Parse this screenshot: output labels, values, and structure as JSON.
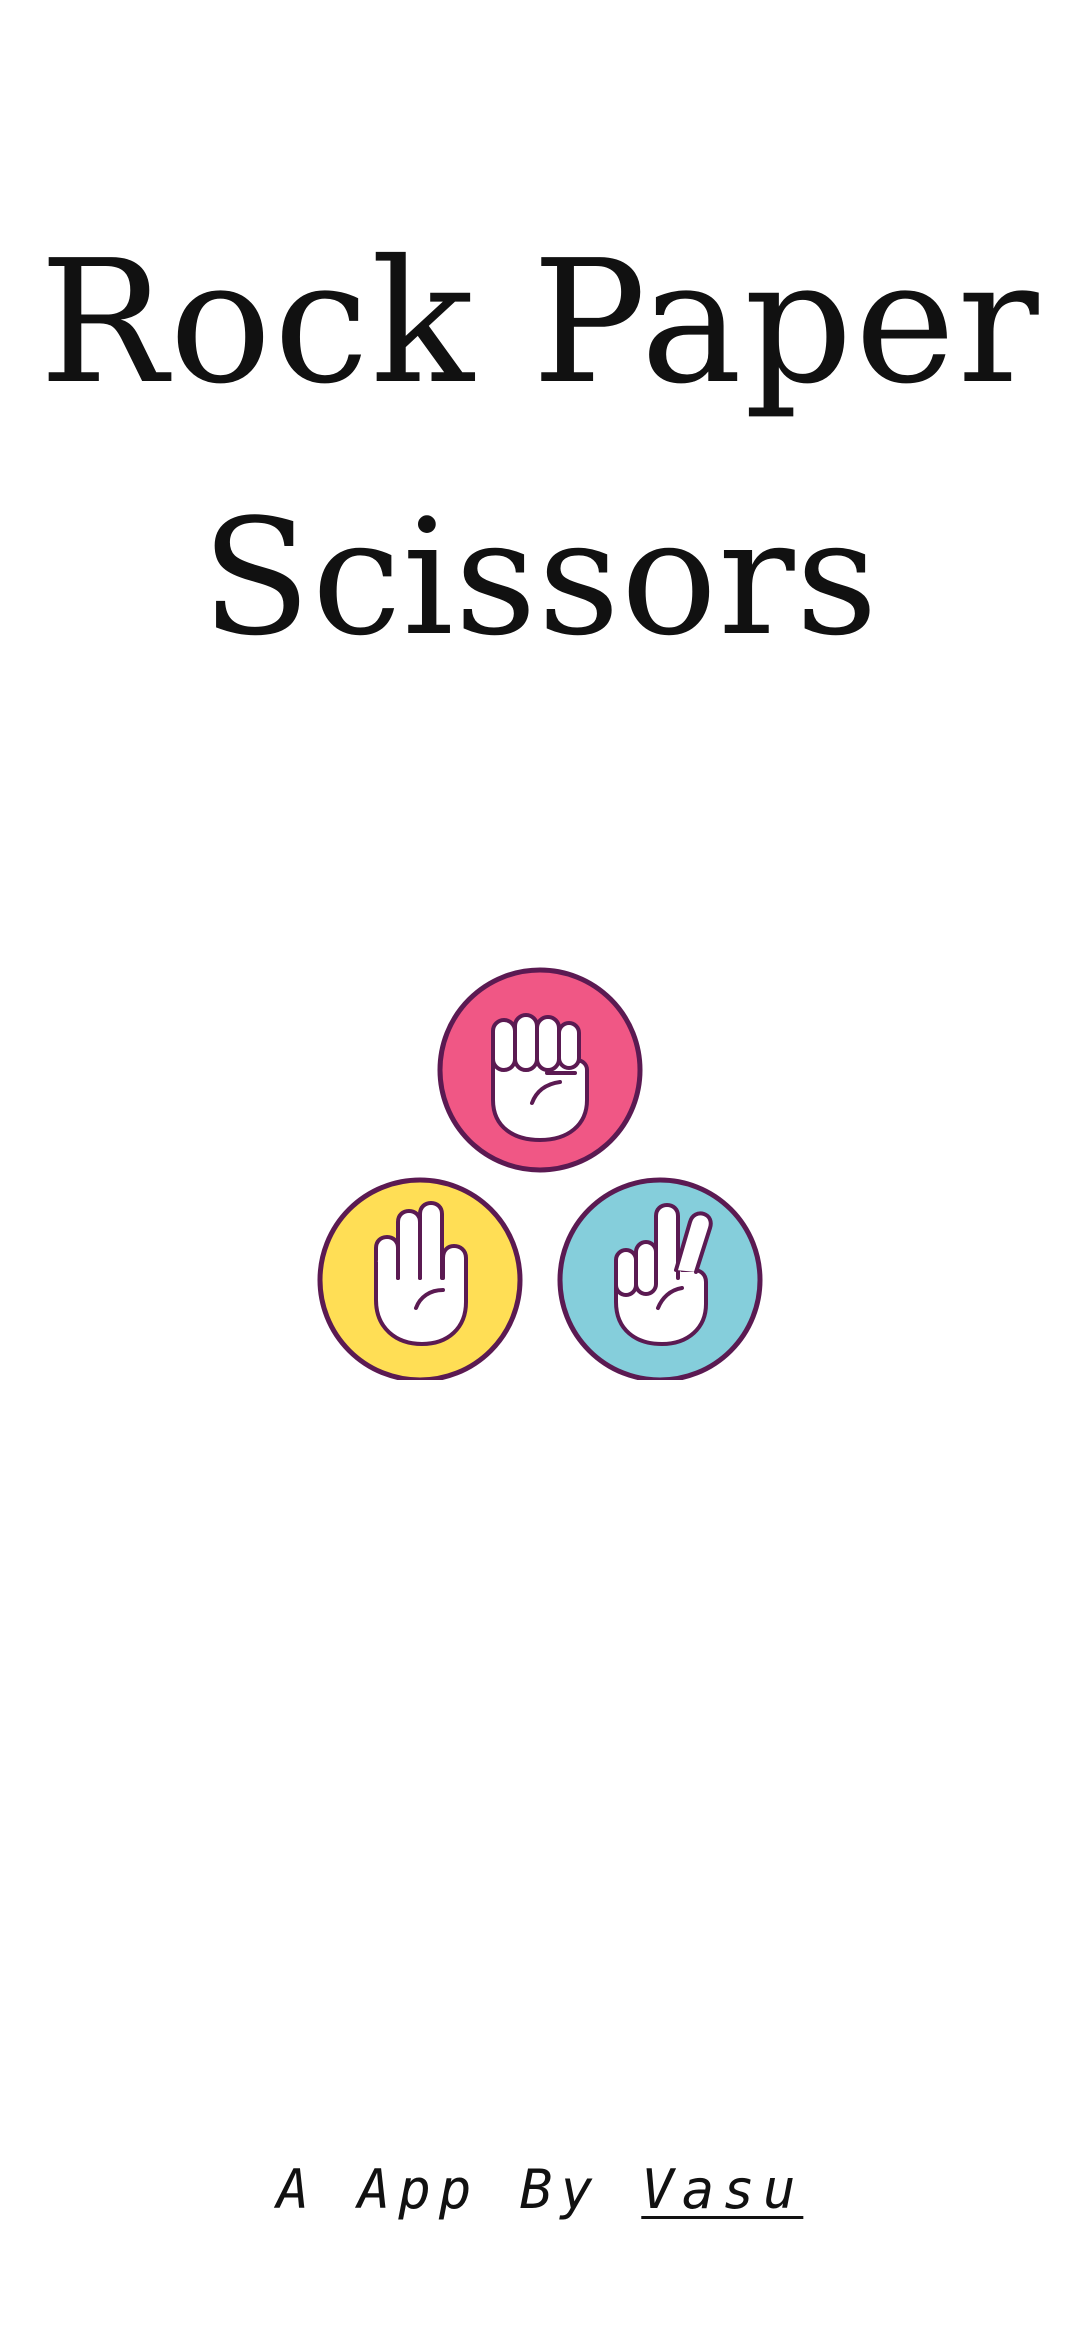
{
  "title": {
    "line1": "Rock Paper",
    "line2": "Scissors"
  },
  "hands": {
    "rock": {
      "icon": "rock-fist-icon",
      "color": "#F05785"
    },
    "paper": {
      "icon": "paper-hand-icon",
      "color": "#FFDE55"
    },
    "scissors": {
      "icon": "scissors-hand-icon",
      "color": "#85CEDB"
    },
    "outline_color": "#5B1A52"
  },
  "footer": {
    "prefix": "A App By",
    "author": "Vasu"
  }
}
